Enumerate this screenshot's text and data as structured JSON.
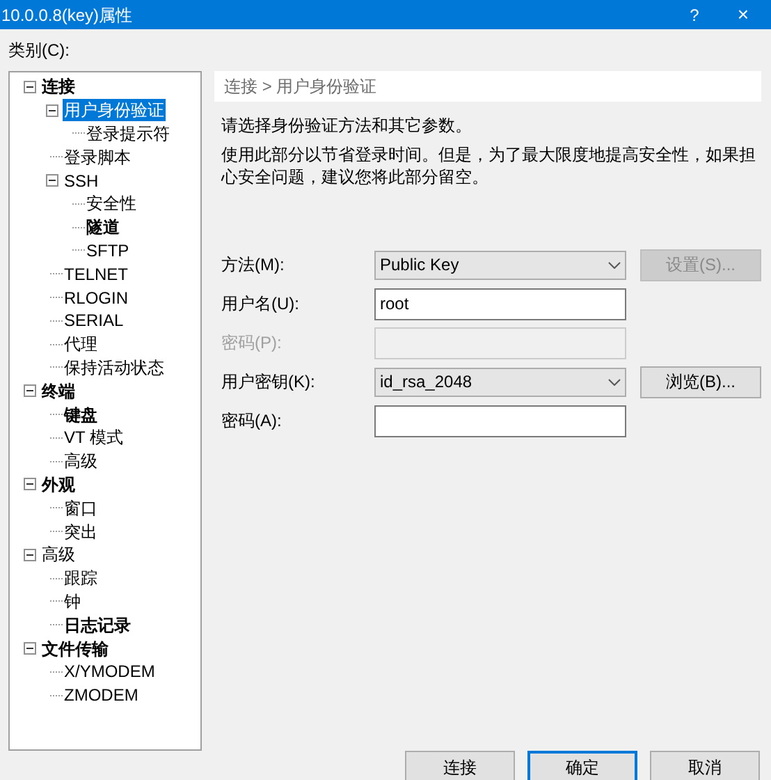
{
  "window": {
    "title": "10.0.0.8(key)属性",
    "help": "?",
    "close": "×"
  },
  "category_label": "类别(C):",
  "tree": [
    {
      "label": "连接",
      "bold": true,
      "expanded": true,
      "selected": false,
      "children": [
        {
          "label": "用户身份验证",
          "bold": false,
          "expanded": true,
          "selected": true,
          "children": [
            {
              "label": "登录提示符",
              "bold": false,
              "selected": false
            }
          ]
        },
        {
          "label": "登录脚本",
          "bold": false,
          "selected": false
        },
        {
          "label": "SSH",
          "bold": false,
          "expanded": true,
          "selected": false,
          "children": [
            {
              "label": "安全性",
              "bold": false,
              "selected": false
            },
            {
              "label": "隧道",
              "bold": true,
              "selected": false
            },
            {
              "label": "SFTP",
              "bold": false,
              "selected": false
            }
          ]
        },
        {
          "label": "TELNET",
          "bold": false,
          "selected": false
        },
        {
          "label": "RLOGIN",
          "bold": false,
          "selected": false
        },
        {
          "label": "SERIAL",
          "bold": false,
          "selected": false
        },
        {
          "label": "代理",
          "bold": false,
          "selected": false
        },
        {
          "label": "保持活动状态",
          "bold": false,
          "selected": false
        }
      ]
    },
    {
      "label": "终端",
      "bold": true,
      "expanded": true,
      "selected": false,
      "children": [
        {
          "label": "键盘",
          "bold": true,
          "selected": false
        },
        {
          "label": "VT 模式",
          "bold": false,
          "selected": false
        },
        {
          "label": "高级",
          "bold": false,
          "selected": false
        }
      ]
    },
    {
      "label": "外观",
      "bold": true,
      "expanded": true,
      "selected": false,
      "children": [
        {
          "label": "窗口",
          "bold": false,
          "selected": false
        },
        {
          "label": "突出",
          "bold": false,
          "selected": false
        }
      ]
    },
    {
      "label": "高级",
      "bold": false,
      "expanded": true,
      "selected": false,
      "children": [
        {
          "label": "跟踪",
          "bold": false,
          "selected": false
        },
        {
          "label": "钟",
          "bold": false,
          "selected": false
        },
        {
          "label": "日志记录",
          "bold": true,
          "selected": false
        }
      ]
    },
    {
      "label": "文件传输",
      "bold": true,
      "expanded": true,
      "selected": false,
      "children": [
        {
          "label": "X/YMODEM",
          "bold": false,
          "selected": false
        },
        {
          "label": "ZMODEM",
          "bold": false,
          "selected": false
        }
      ]
    }
  ],
  "breadcrumb": "连接 > 用户身份验证",
  "intro": "请选择身份验证方法和其它参数。",
  "description": "使用此部分以节省登录时间。但是，为了最大限度地提高安全性，如果担心安全问题，建议您将此部分留空。",
  "form": [
    {
      "label": "方法(M):",
      "kind": "select",
      "value": "Public Key",
      "disabled": false,
      "button": {
        "label": "设置(S)...",
        "disabled": true
      }
    },
    {
      "label": "用户名(U):",
      "kind": "text",
      "value": "root",
      "disabled": false
    },
    {
      "label": "密码(P):",
      "kind": "text",
      "disabled": true
    },
    {
      "label": "用户密钥(K):",
      "kind": "select",
      "value": "id_rsa_2048",
      "disabled": false,
      "button": {
        "label": "浏览(B)...",
        "disabled": false
      }
    },
    {
      "label": "密码(A):",
      "kind": "text",
      "disabled": false
    }
  ],
  "buttons": [
    {
      "label": "连接",
      "focused": false
    },
    {
      "label": "确定",
      "focused": true
    },
    {
      "label": "取消",
      "focused": false
    }
  ]
}
